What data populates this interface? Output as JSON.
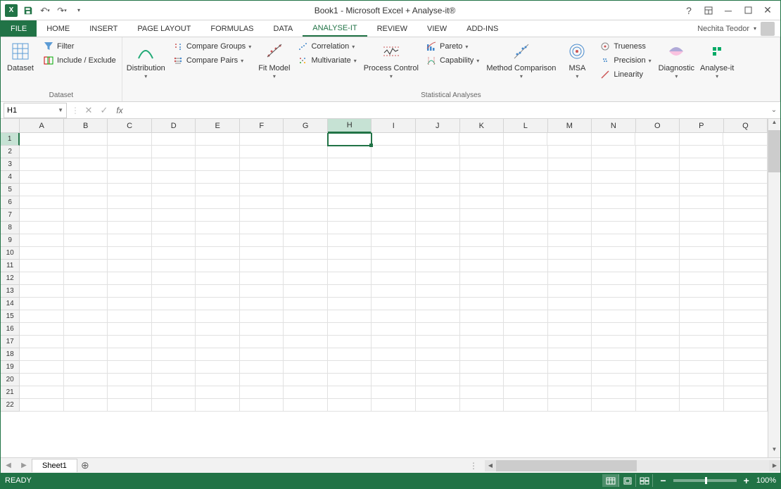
{
  "qat": {
    "app_initials": "X"
  },
  "titlebar": {
    "title": "Book1 - Microsoft Excel + Analyse-it®"
  },
  "tabs": {
    "file": "FILE",
    "items": [
      "HOME",
      "INSERT",
      "PAGE LAYOUT",
      "FORMULAS",
      "DATA",
      "ANALYSE-IT",
      "REVIEW",
      "VIEW",
      "ADD-INS"
    ],
    "active": "ANALYSE-IT"
  },
  "user": {
    "name": "Nechita Teodor"
  },
  "ribbon": {
    "groups": [
      {
        "label": "Dataset",
        "big": [
          {
            "label": "Dataset"
          }
        ],
        "stacks": [
          [
            {
              "label": "Filter"
            },
            {
              "label": "Include / Exclude"
            }
          ]
        ]
      },
      {
        "label": "Statistical Analyses",
        "content": [
          {
            "type": "big",
            "label": "Distribution",
            "dd": true
          },
          {
            "type": "stack",
            "items": [
              {
                "label": "Compare Groups",
                "dd": true
              },
              {
                "label": "Compare Pairs",
                "dd": true
              }
            ]
          },
          {
            "type": "big",
            "label": "Fit Model",
            "dd": true
          },
          {
            "type": "stack",
            "items": [
              {
                "label": "Correlation",
                "dd": true
              },
              {
                "label": "Multivariate",
                "dd": true
              }
            ]
          },
          {
            "type": "big",
            "label": "Process Control",
            "dd": true
          },
          {
            "type": "stack",
            "items": [
              {
                "label": "Pareto",
                "dd": true
              },
              {
                "label": "Capability",
                "dd": true
              }
            ]
          },
          {
            "type": "big",
            "label": "Method Comparison",
            "dd": true
          },
          {
            "type": "big",
            "label": "MSA",
            "dd": true
          },
          {
            "type": "stack",
            "items": [
              {
                "label": "Trueness"
              },
              {
                "label": "Precision",
                "dd": true
              },
              {
                "label": "Linearity"
              }
            ]
          },
          {
            "type": "big",
            "label": "Diagnostic",
            "dd": true
          },
          {
            "type": "big",
            "label": "Analyse-it",
            "dd": true
          }
        ]
      }
    ]
  },
  "namebox": {
    "value": "H1"
  },
  "columns": [
    "A",
    "B",
    "C",
    "D",
    "E",
    "F",
    "G",
    "H",
    "I",
    "J",
    "K",
    "L",
    "M",
    "N",
    "O",
    "P",
    "Q"
  ],
  "active_col": "H",
  "rows_count": 22,
  "active_row": 1,
  "sheets": {
    "active": "Sheet1"
  },
  "status": {
    "ready": "READY",
    "zoom": "100%"
  }
}
